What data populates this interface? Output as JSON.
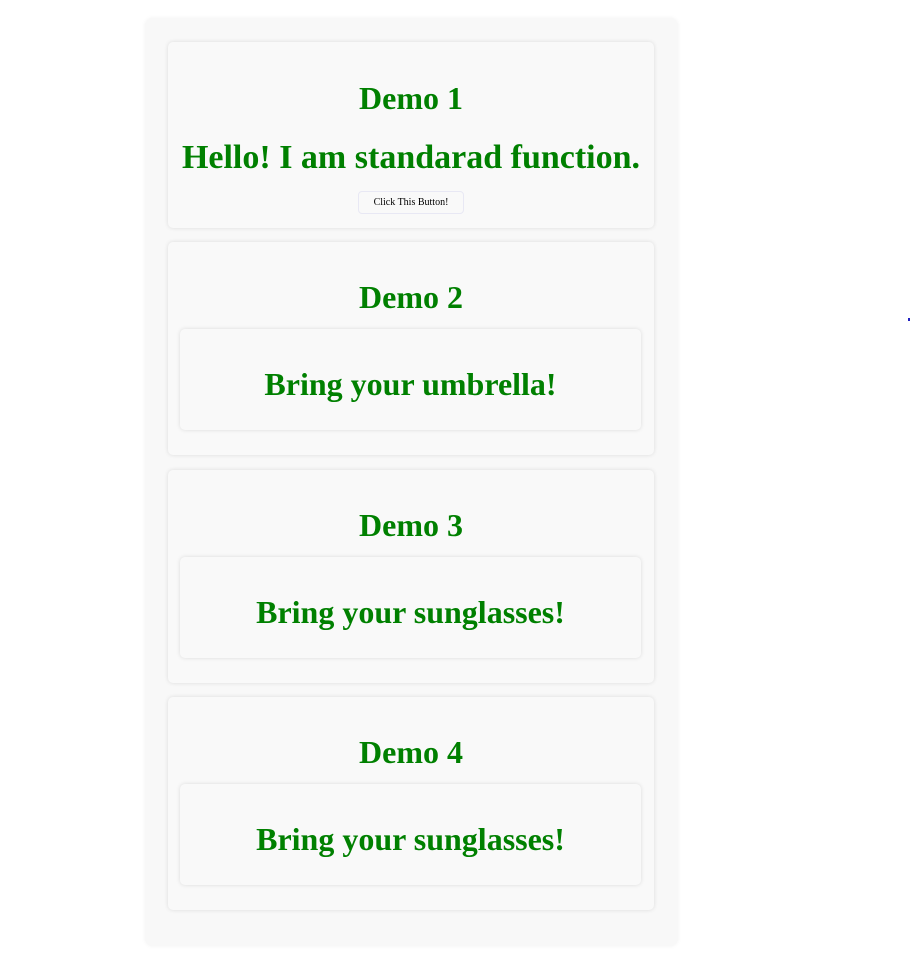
{
  "demos": [
    {
      "title": "Demo 1",
      "message": "Hello! I am standarad function.",
      "button_label": "Click This Button!"
    },
    {
      "title": "Demo 2",
      "message": "Bring your umbrella!"
    },
    {
      "title": "Demo 3",
      "message": "Bring your sunglasses!"
    },
    {
      "title": "Demo 4",
      "message": "Bring your sunglasses!"
    }
  ],
  "colors": {
    "text_accent": "#008000"
  }
}
